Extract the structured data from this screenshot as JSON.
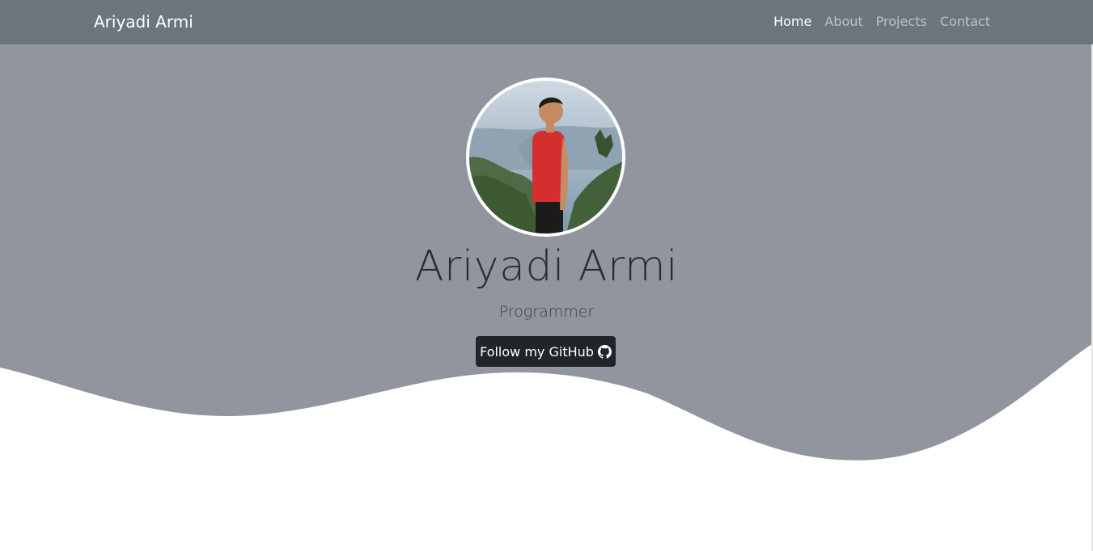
{
  "navbar": {
    "brand": "Ariyadi Armi",
    "links": [
      {
        "label": "Home",
        "active": true
      },
      {
        "label": "About",
        "active": false
      },
      {
        "label": "Projects",
        "active": false
      },
      {
        "label": "Contact",
        "active": false
      }
    ]
  },
  "hero": {
    "name": "Ariyadi Armi",
    "role": "Programmer",
    "button_label": "Follow my GitHub",
    "button_icon": "github-icon",
    "avatar_icon": "profile-photo"
  },
  "colors": {
    "navbar_bg": "#6c757d",
    "hero_bg": "#91959d",
    "button_bg": "#212529",
    "page_bg": "#ffffff"
  }
}
